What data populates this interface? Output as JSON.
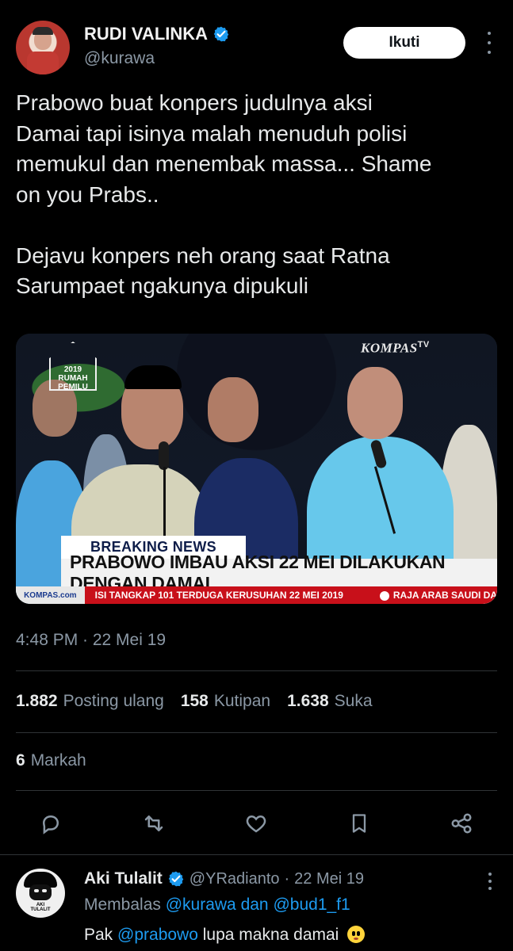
{
  "author": {
    "name": "RUDI VALINKA",
    "handle": "@kurawa"
  },
  "header": {
    "follow_label": "Ikuti"
  },
  "tweet": {
    "text": "Prabowo buat konpers judulnya aksi\nDamai tapi isinya malah menuduh polisi\nmemukul dan menembak massa... Shame\non you Prabs..\n\nDejavu konpers neh orang saat Ratna\nSarumpaet ngakunya dipukuli",
    "timestamp": "4:48 PM · 22 Mei 19"
  },
  "media": {
    "top_left_logo_year": "2019",
    "top_left_logo_line1": "RUMAH",
    "top_left_logo_line2": "PEMILU",
    "kompas_brand": "KOMPAS",
    "kompas_superscript": "TV",
    "breaking_label": "BREAKING NEWS",
    "headline": "PRABOWO IMBAU AKSI 22 MEI DILAKUKAN DENGAN DAMAI",
    "ticker_left": "KOMPAS.com",
    "ticker_text_1": "ISI TANGKAP 101 TERDUGA KERUSUHAN 22 MEI 2019",
    "ticker_text_2": "RAJA ARAB SAUDI DA"
  },
  "stats": {
    "retweets_value": "1.882",
    "retweets_label": "Posting ulang",
    "quotes_value": "158",
    "quotes_label": "Kutipan",
    "likes_value": "1.638",
    "likes_label": "Suka",
    "bookmarks_value": "6",
    "bookmarks_label": "Markah"
  },
  "actions": {
    "icons": [
      "reply-icon",
      "retweet-icon",
      "like-icon",
      "bookmark-icon",
      "share-icon"
    ]
  },
  "reply": {
    "name": "Aki Tulalit",
    "handle": "@YRadianto",
    "separator": "·",
    "date": "22 Mei 19",
    "replying_prefix": "Membalas",
    "replying_user1": "@kurawa",
    "replying_connector": "dan",
    "replying_user2": "@bud1_f1",
    "text_prefix": "Pak",
    "text_mention": "@prabowo",
    "text_suffix": "lupa makna damai",
    "avatar_text_line1": "AKI",
    "avatar_text_line2": "TULALIT"
  },
  "colors": {
    "background": "#000000",
    "primary_text": "#e7e9ea",
    "secondary_text": "#8b98a5",
    "accent": "#1d9bf0",
    "divider": "#2f3336"
  }
}
